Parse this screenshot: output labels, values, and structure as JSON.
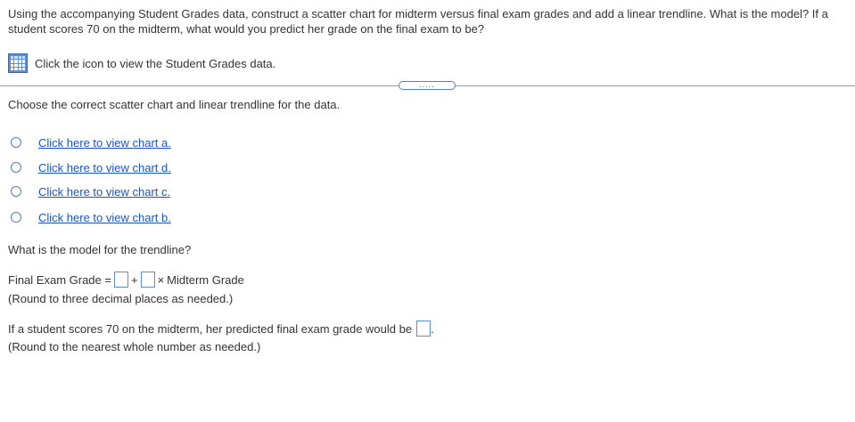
{
  "question": {
    "text": "Using the accompanying Student Grades data, construct a scatter chart for midterm versus final exam grades and add a linear trendline. What is the model? If a student scores 70 on the midterm, what would you predict her grade on the final exam to be?"
  },
  "data_link": {
    "icon": "table-icon",
    "text": "Click the icon to view the Student Grades data."
  },
  "expand_button": {
    "label": "....."
  },
  "instruction": "Choose the correct scatter chart and linear trendline for the data.",
  "options": [
    {
      "label": "Click here to view chart a."
    },
    {
      "label": "Click here to view chart d."
    },
    {
      "label": "Click here to view chart c."
    },
    {
      "label": "Click here to view chart b."
    }
  ],
  "model_prompt": "What is the model for the trendline?",
  "equation": {
    "lhs": "Final Exam Grade =",
    "plus": "+",
    "times": "×",
    "rhs": "Midterm Grade",
    "hint": "(Round to three decimal places as needed.)"
  },
  "prediction": {
    "text": "If a student scores 70 on the midterm, her predicted final exam grade would be",
    "end": ".",
    "hint": "(Round to the nearest whole number as needed.)"
  }
}
